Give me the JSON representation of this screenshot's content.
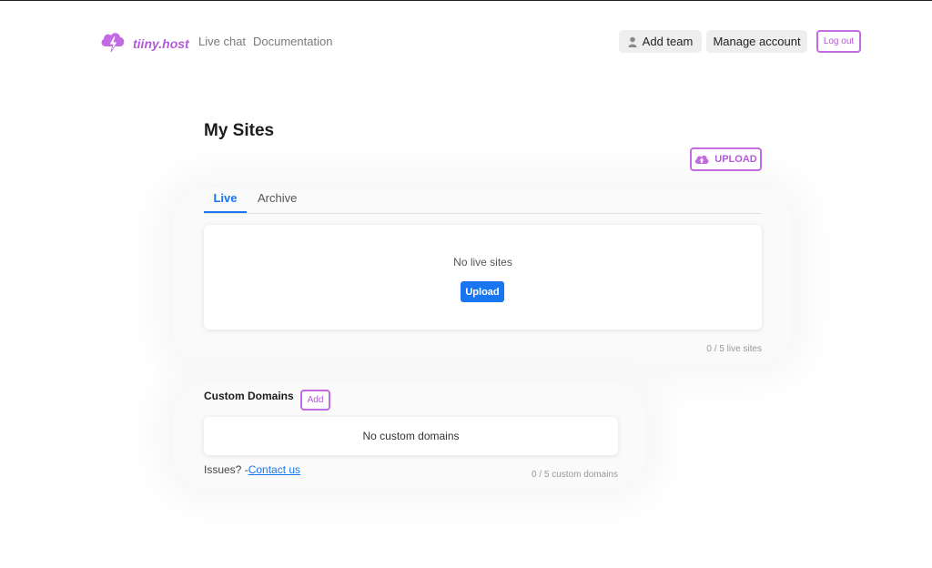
{
  "nav": {
    "brand": "tiiny.host",
    "links": [
      "Live chat",
      "Documentation"
    ],
    "add_team_label": "Add team",
    "manage_account_label": "Manage account",
    "logout_label": "Log out"
  },
  "page": {
    "title": "My Sites",
    "upload_label": "UPLOAD"
  },
  "tabs": [
    {
      "label": "Live",
      "active": true
    },
    {
      "label": "Archive",
      "active": false
    }
  ],
  "live_sites": {
    "empty_text": "No live sites",
    "upload_button": "Upload",
    "count_text": "0 / 5 live sites"
  },
  "custom_domains": {
    "heading": "Custom Domains",
    "add_label": "Add",
    "empty_text": "No custom domains",
    "count_text": "0 / 5 custom domains"
  },
  "footer": {
    "issues_text": "Issues? -",
    "contact_label": "Contact us"
  },
  "colors": {
    "brand_purple": "#b35ad8",
    "primary_blue": "#1976f0"
  }
}
